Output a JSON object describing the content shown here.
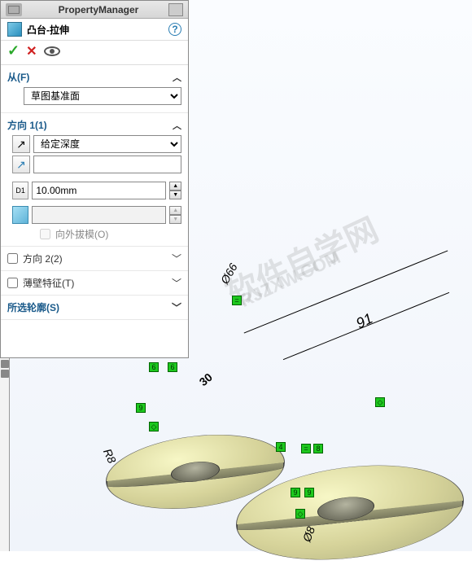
{
  "panel": {
    "title": "PropertyManager",
    "feature_name": "凸台-拉伸",
    "help": "?",
    "sections": {
      "from": {
        "label": "从(F)",
        "condition": "草图基准面"
      },
      "dir1": {
        "label": "方向 1(1)",
        "end_condition": "给定深度",
        "selection_value": "",
        "depth": "10.00mm",
        "draft_value": "",
        "draft_outward": "向外拔模(O)"
      },
      "dir2": {
        "label": "方向 2(2)"
      },
      "thin": {
        "label": "薄壁特征(T)"
      },
      "contours": {
        "label": "所选轮廓(S)"
      }
    }
  },
  "viewport": {
    "dimensions": {
      "d66": "Ø66",
      "d91": "91",
      "d30": "30",
      "r8": "R8",
      "d8": "Ø8"
    },
    "watermark_a": "软件自学网",
    "watermark_b": "RJZXW.COM"
  }
}
